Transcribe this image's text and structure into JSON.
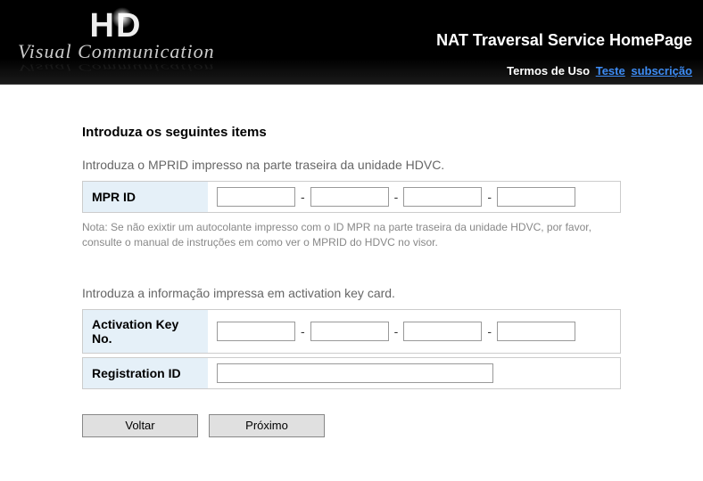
{
  "header": {
    "logo_main": "HD",
    "logo_sub": "Visual Communication",
    "title": "NAT Traversal Service HomePage",
    "terms_label": "Termos de Uso",
    "link_teste": "Teste",
    "link_subscricao": "subscrição"
  },
  "form": {
    "section_title": "Introduza os seguintes items",
    "mprid_instruction": "Introduza o MPRID impresso na parte traseira da unidade HDVC.",
    "mprid_label": "MPR ID",
    "mprid_note": "Nota: Se não exixtir um autocolante impresso com o ID MPR na parte traseira da unidade HDVC, por favor, consulte o manual de instruções em como ver o MPRID do HDVC no visor.",
    "activation_instruction": "Introduza a informação impressa em activation key card.",
    "activation_label": "Activation Key No.",
    "registration_label": "Registration ID",
    "separator": "-",
    "mprid": {
      "p1": "",
      "p2": "",
      "p3": "",
      "p4": ""
    },
    "activation": {
      "p1": "",
      "p2": "",
      "p3": "",
      "p4": ""
    },
    "registration_id": ""
  },
  "buttons": {
    "back": "Voltar",
    "next": "Próximo"
  }
}
